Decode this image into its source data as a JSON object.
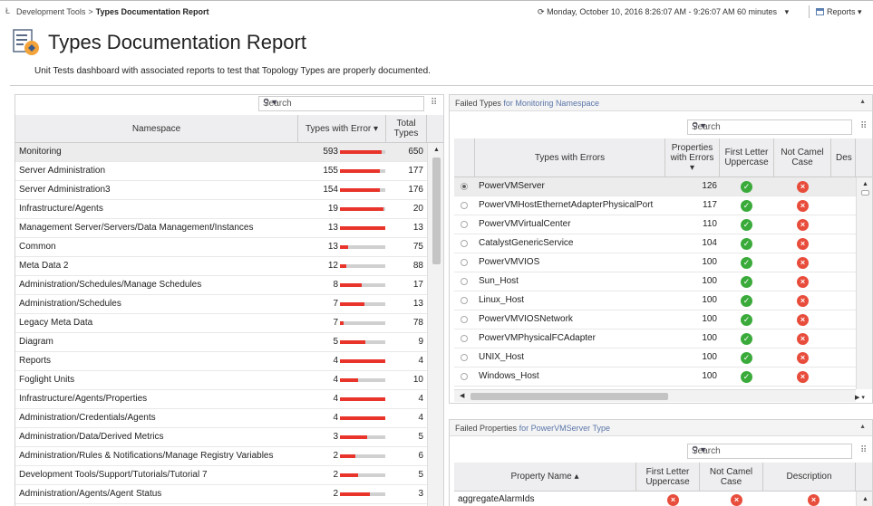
{
  "breadcrumb": {
    "parent": "Development Tools",
    "separator": ">",
    "current": "Types Documentation Report"
  },
  "time_range": "Monday, October 10, 2016 8:26:07 AM - 9:26:07 AM 60 minutes",
  "reports_label": "Reports",
  "page": {
    "title": "Types Documentation Report",
    "subtitle": "Unit Tests dashboard with associated reports to test that Topology Types are properly documented."
  },
  "left_table": {
    "search_placeholder": "Search",
    "columns": {
      "namespace": "Namespace",
      "errors": "Types with Error",
      "total": "Total Types"
    },
    "rows": [
      {
        "namespace": "Monitoring",
        "errors": 593,
        "total": 650,
        "selected": true
      },
      {
        "namespace": "Server Administration",
        "errors": 155,
        "total": 177
      },
      {
        "namespace": "Server Administration3",
        "errors": 154,
        "total": 176
      },
      {
        "namespace": "Infrastructure/Agents",
        "errors": 19,
        "total": 20
      },
      {
        "namespace": "Management Server/Servers/Data Management/Instances",
        "errors": 13,
        "total": 13
      },
      {
        "namespace": "Common",
        "errors": 13,
        "total": 75
      },
      {
        "namespace": "Meta Data 2",
        "errors": 12,
        "total": 88
      },
      {
        "namespace": "Administration/Schedules/Manage Schedules",
        "errors": 8,
        "total": 17
      },
      {
        "namespace": "Administration/Schedules",
        "errors": 7,
        "total": 13
      },
      {
        "namespace": "Legacy Meta Data",
        "errors": 7,
        "total": 78
      },
      {
        "namespace": "Diagram",
        "errors": 5,
        "total": 9
      },
      {
        "namespace": "Reports",
        "errors": 4,
        "total": 4
      },
      {
        "namespace": "Foglight Units",
        "errors": 4,
        "total": 10
      },
      {
        "namespace": "Infrastructure/Agents/Properties",
        "errors": 4,
        "total": 4
      },
      {
        "namespace": "Administration/Credentials/Agents",
        "errors": 4,
        "total": 4
      },
      {
        "namespace": "Administration/Data/Derived Metrics",
        "errors": 3,
        "total": 5
      },
      {
        "namespace": "Administration/Rules & Notifications/Manage Registry Variables",
        "errors": 2,
        "total": 6
      },
      {
        "namespace": "Development Tools/Support/Tutorials/Tutorial 7",
        "errors": 2,
        "total": 5
      },
      {
        "namespace": "Administration/Agents/Agent Status",
        "errors": 2,
        "total": 3
      }
    ]
  },
  "failed_types": {
    "title_prefix": "Failed Types",
    "title_for": "for Monitoring",
    "title_suffix": "Namespace",
    "search_placeholder": "Search",
    "columns": {
      "type": "Types with Errors",
      "props": "Properties with Errors",
      "first": "First Letter Uppercase",
      "camel": "Not Camel Case",
      "desc": "Des"
    },
    "rows": [
      {
        "name": "PowerVMServer",
        "props": 126,
        "first_ok": true,
        "camel_ok": false,
        "selected": true
      },
      {
        "name": "PowerVMHostEthernetAdapterPhysicalPort",
        "props": 117,
        "first_ok": true,
        "camel_ok": false
      },
      {
        "name": "PowerVMVirtualCenter",
        "props": 110,
        "first_ok": true,
        "camel_ok": false
      },
      {
        "name": "CatalystGenericService",
        "props": 104,
        "first_ok": true,
        "camel_ok": false
      },
      {
        "name": "PowerVMVIOS",
        "props": 100,
        "first_ok": true,
        "camel_ok": false
      },
      {
        "name": "Sun_Host",
        "props": 100,
        "first_ok": true,
        "camel_ok": false
      },
      {
        "name": "Linux_Host",
        "props": 100,
        "first_ok": true,
        "camel_ok": false
      },
      {
        "name": "PowerVMVIOSNetwork",
        "props": 100,
        "first_ok": true,
        "camel_ok": false
      },
      {
        "name": "PowerVMPhysicalFCAdapter",
        "props": 100,
        "first_ok": true,
        "camel_ok": false
      },
      {
        "name": "UNIX_Host",
        "props": 100,
        "first_ok": true,
        "camel_ok": false
      },
      {
        "name": "Windows_Host",
        "props": 100,
        "first_ok": true,
        "camel_ok": false
      }
    ]
  },
  "failed_props": {
    "title_prefix": "Failed Properties",
    "title_for": "for PowerVMServer",
    "title_suffix": "Type",
    "search_placeholder": "Search",
    "columns": {
      "name": "Property Name",
      "first": "First Letter Uppercase",
      "camel": "Not Camel Case",
      "desc": "Description"
    },
    "rows": [
      {
        "name": "aggregateAlarmIds",
        "first_ok": false,
        "camel_ok": false,
        "desc_ok": false
      }
    ]
  },
  "colors": {
    "error_bar": "#e8342a",
    "bar_track": "#d0d0d0",
    "ok": "#3aaa3a",
    "bad": "#e84d3c",
    "link": "#5a75a8"
  },
  "icons": [
    "search-icon",
    "settings-icon",
    "check-icon",
    "error-icon",
    "report-icon",
    "clock-icon"
  ]
}
